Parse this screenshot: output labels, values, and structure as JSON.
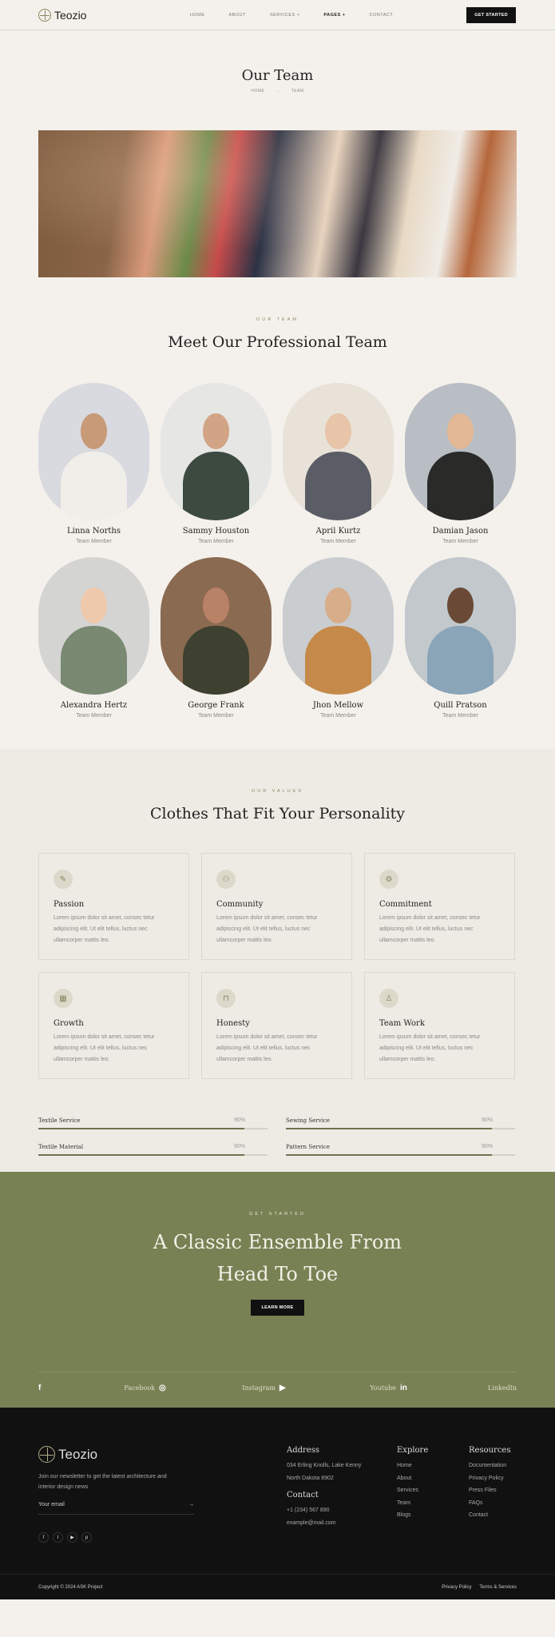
{
  "header": {
    "logo": "Teozio",
    "nav": [
      {
        "label": "HOME",
        "active": false
      },
      {
        "label": "ABOUT",
        "active": false
      },
      {
        "label": "SERVICES +",
        "active": false
      },
      {
        "label": "PAGES +",
        "active": true
      },
      {
        "label": "CONTACT",
        "active": false
      }
    ],
    "cta": "GET STARTED"
  },
  "page_title": {
    "title": "Our Team",
    "breadcrumb": [
      "HOME",
      "→",
      "TEAM"
    ]
  },
  "team": {
    "kicker": "OUR TEAM",
    "title": "Meet Our Professional Team",
    "members": [
      {
        "name": "Linna Norths",
        "role": "Team Member"
      },
      {
        "name": "Sammy Houston",
        "role": "Team Member"
      },
      {
        "name": "April Kurtz",
        "role": "Team Member"
      },
      {
        "name": "Damian Jason",
        "role": "Team Member"
      },
      {
        "name": "Alexandra Hertz",
        "role": "Team Member"
      },
      {
        "name": "George Frank",
        "role": "Team Member"
      },
      {
        "name": "Jhon Mellow",
        "role": "Team Member"
      },
      {
        "name": "Quill Pratson",
        "role": "Team Member"
      }
    ]
  },
  "values": {
    "kicker": "OUR VALUES",
    "title": "Clothes That Fit Your Personality",
    "cards": [
      {
        "icon": "pencil-icon",
        "glyph": "✎",
        "title": "Passion",
        "text": "Lorem ipsum dolor sit amet, consec tetur adipiscing elit. Ut elit tellus, luctus nec ullamcorper mattis leo."
      },
      {
        "icon": "users-icon",
        "glyph": "⚇",
        "title": "Community",
        "text": "Lorem ipsum dolor sit amet, consec tetur adipiscing elit. Ut elit tellus, luctus nec ullamcorper mattis leo."
      },
      {
        "icon": "gear-icon",
        "glyph": "⚙",
        "title": "Commitment",
        "text": "Lorem ipsum dolor sit amet, consec tetur adipiscing elit. Ut elit tellus, luctus nec ullamcorper mattis leo."
      },
      {
        "icon": "chart-icon",
        "glyph": "▦",
        "title": "Growth",
        "text": "Lorem ipsum dolor sit amet, consec tetur adipiscing elit. Ut elit tellus, luctus nec ullamcorper mattis leo."
      },
      {
        "icon": "lock-icon",
        "glyph": "⊓",
        "title": "Honesty",
        "text": "Lorem ipsum dolor sit amet, consec tetur adipiscing elit. Ut elit tellus, luctus nec ullamcorper mattis leo."
      },
      {
        "icon": "user-icon",
        "glyph": "♙",
        "title": "Team Work",
        "text": "Lorem ipsum dolor sit amet, consec tetur adipiscing elit. Ut elit tellus, luctus nec ullamcorper mattis leo."
      }
    ],
    "skills": [
      {
        "name": "Textile Service",
        "value": "90%",
        "percent": 90
      },
      {
        "name": "Sewing Service",
        "value": "90%",
        "percent": 90
      },
      {
        "name": "Textile Material",
        "value": "90%",
        "percent": 90
      },
      {
        "name": "Pattern Service",
        "value": "90%",
        "percent": 90
      }
    ]
  },
  "cta_section": {
    "kicker": "GET STARTED",
    "title_line1": "A Classic Ensemble From",
    "title_line2": "Head To Toe",
    "button": "LEARN MORE",
    "social": [
      {
        "icon": "facebook-icon",
        "glyph": "f",
        "label": "Facebook"
      },
      {
        "icon": "instagram-icon",
        "glyph": "◎",
        "label": "Instagram"
      },
      {
        "icon": "youtube-icon",
        "glyph": "▶",
        "label": "Youtube"
      },
      {
        "icon": "linkedin-icon",
        "glyph": "in",
        "label": "LinkedIn"
      }
    ]
  },
  "footer": {
    "logo": "Teozio",
    "newsletter": "Join our newsletter to get the latest architecture and interior design news",
    "email_placeholder": "Your email",
    "social_icons": [
      {
        "icon": "facebook-icon",
        "glyph": "f"
      },
      {
        "icon": "twitter-icon",
        "glyph": "t"
      },
      {
        "icon": "youtube-icon",
        "glyph": "▶"
      },
      {
        "icon": "pinterest-icon",
        "glyph": "p"
      }
    ],
    "address_title": "Address",
    "address_lines": [
      "034 Erling Knolls, Lake Kenny",
      "North Dakota 8902"
    ],
    "contact_title": "Contact",
    "contact_lines": [
      "+1 (234) 567 890",
      "example@mail.com"
    ],
    "explore_title": "Explore",
    "explore": [
      "Home",
      "About",
      "Services",
      "Team",
      "Blogs"
    ],
    "resources_title": "Resources",
    "resources": [
      "Documentation",
      "Privacy Policy",
      "Press Files",
      "FAQs",
      "Contact"
    ],
    "copyright": "Copyright © 2024 ASK Project",
    "bottom_links": [
      "Privacy Policy",
      "Terms & Services"
    ]
  }
}
